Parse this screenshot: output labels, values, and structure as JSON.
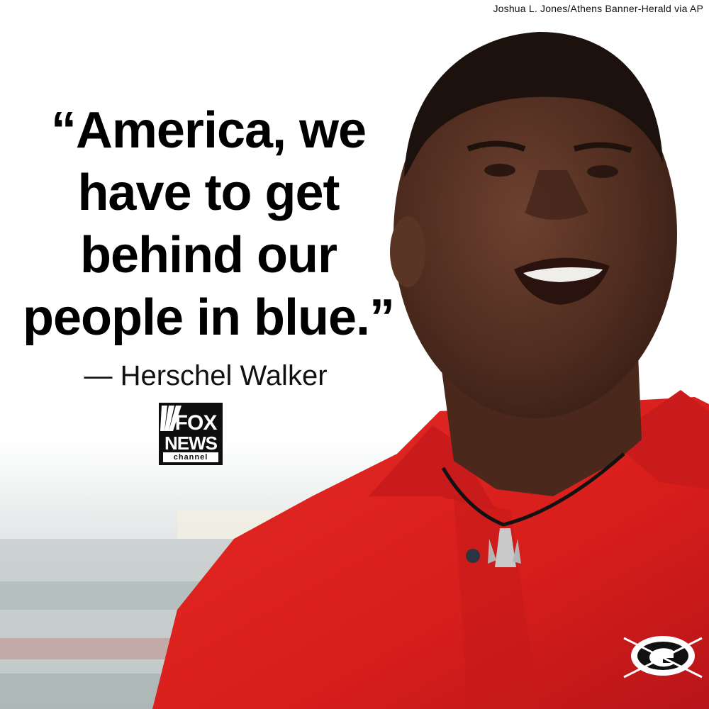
{
  "photo_credit": "Joshua L. Jones/Athens Banner-Herald via AP",
  "quote_lines": [
    "“America, we",
    "have to get",
    "behind our",
    "people in blue.”"
  ],
  "attribution": "— Herschel Walker",
  "logo": {
    "word1": "FOX",
    "word2": "NEWS",
    "word3": "channel"
  },
  "colors": {
    "shirt": "#e0221f",
    "skin": "#5a3424",
    "text": "#000000",
    "background": "#ffffff"
  },
  "icons": {
    "logo": "fox-news-logo-icon",
    "shirt-emblem": "georgia-g-logo-icon"
  }
}
